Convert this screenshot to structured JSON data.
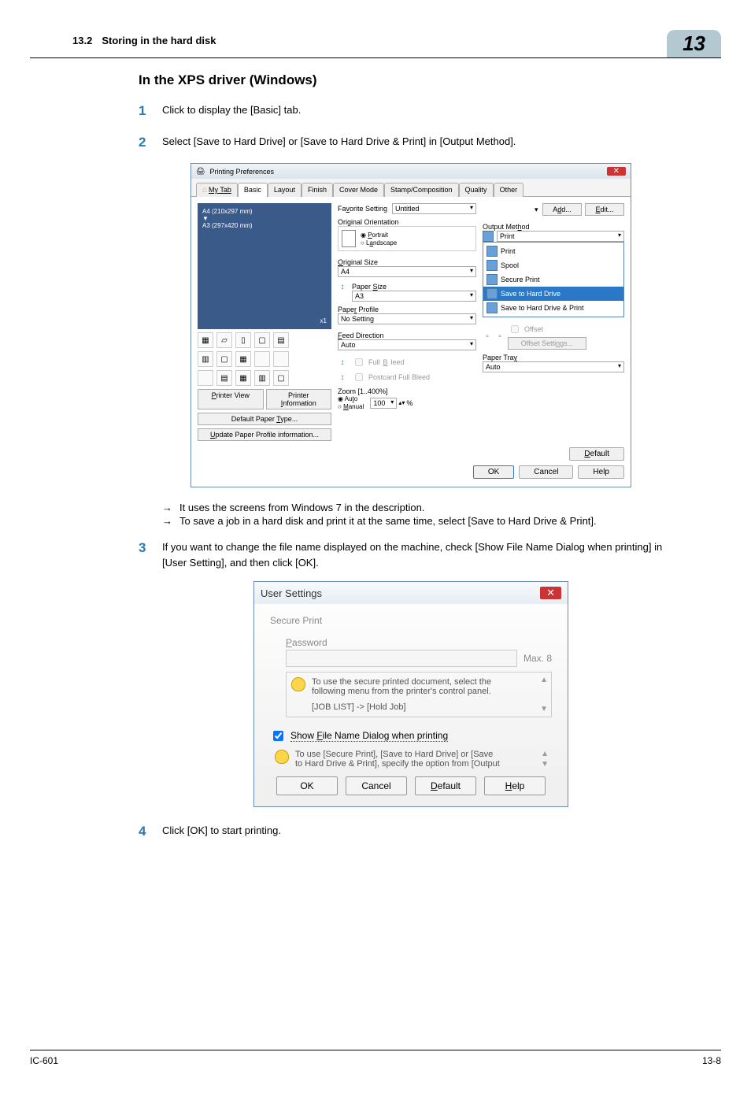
{
  "header": {
    "section": "13.2",
    "title": "Storing in the hard disk",
    "chapter": "13"
  },
  "h3": "In the XPS driver (Windows)",
  "steps": {
    "s1": "Click to display the [Basic] tab.",
    "s2": "Select [Save to Hard Drive] or [Save to Hard Drive & Print] in [Output Method].",
    "s2_sub1": "It uses the screens from Windows 7 in the description.",
    "s2_sub2": "To save a job in a hard disk and print it at the same time, select [Save to Hard Drive & Print].",
    "s3": "If you want to change the file name displayed on the machine, check [Show File Name Dialog when printing] in [User Setting], and then click [OK].",
    "s4": "Click [OK] to start printing."
  },
  "arrow": "→",
  "printprefs": {
    "title": "Printing Preferences",
    "tabs": [
      "My Tab",
      "Basic",
      "Layout",
      "Finish",
      "Cover Mode",
      "Stamp/Composition",
      "Quality",
      "Other"
    ],
    "left": {
      "size1": "A4 (210x297 mm)",
      "size2": "A3 (297x420 mm)",
      "x1": "x1",
      "printer_view": "Printer View",
      "printer_info": "Printer Information",
      "default_paper": "Default Paper Type...",
      "update_profile": "Update Paper Profile information..."
    },
    "mid": {
      "favorite": "Favorite Setting",
      "favorite_val": "Untitled",
      "orig_orient": "Original Orientation",
      "portrait": "Portrait",
      "landscape": "Landscape",
      "orig_size": "Original Size",
      "orig_size_val": "A4",
      "paper_size": "Paper Size",
      "paper_size_val": "A3",
      "paper_profile": "Paper Profile",
      "paper_profile_val": "No Setting",
      "feed_dir": "Feed Direction",
      "feed_dir_val": "Auto",
      "full_bleed": "Full Bleed",
      "postcard": "Postcard Full Bleed",
      "zoom": "Zoom [1..400%]",
      "auto": "Auto",
      "manual": "Manual",
      "zoom_val": "100",
      "percent": "%"
    },
    "right": {
      "add": "Add...",
      "edit": "Edit...",
      "output_method": "Output Method",
      "om_val": "Print",
      "items": [
        "Print",
        "Spool",
        "Secure Print",
        "Save to Hard Drive",
        "Save to Hard Drive & Print"
      ],
      "offset": "Offset",
      "offset_settings": "Offset Settings...",
      "paper_tray": "Paper Tray",
      "paper_tray_val": "Auto"
    },
    "default_btn": "Default",
    "ok": "OK",
    "cancel": "Cancel",
    "help": "Help"
  },
  "usersettings": {
    "title": "User Settings",
    "secure": "Secure Print",
    "pwd": "Password",
    "max": "Max. 8",
    "hint1a": "To use the secure printed document, select the",
    "hint1b": "following menu from the printer's control panel.",
    "hint1c": "[JOB LIST] -> [Hold Job]",
    "chk": "Show File Name Dialog when printing",
    "hint2a": "To use [Secure Print], [Save to Hard Drive] or [Save",
    "hint2b": "to Hard Drive & Print], specify the option from [Output",
    "ok": "OK",
    "cancel": "Cancel",
    "default": "Default",
    "help": "Help"
  },
  "footer": {
    "left": "IC-601",
    "right": "13-8"
  }
}
